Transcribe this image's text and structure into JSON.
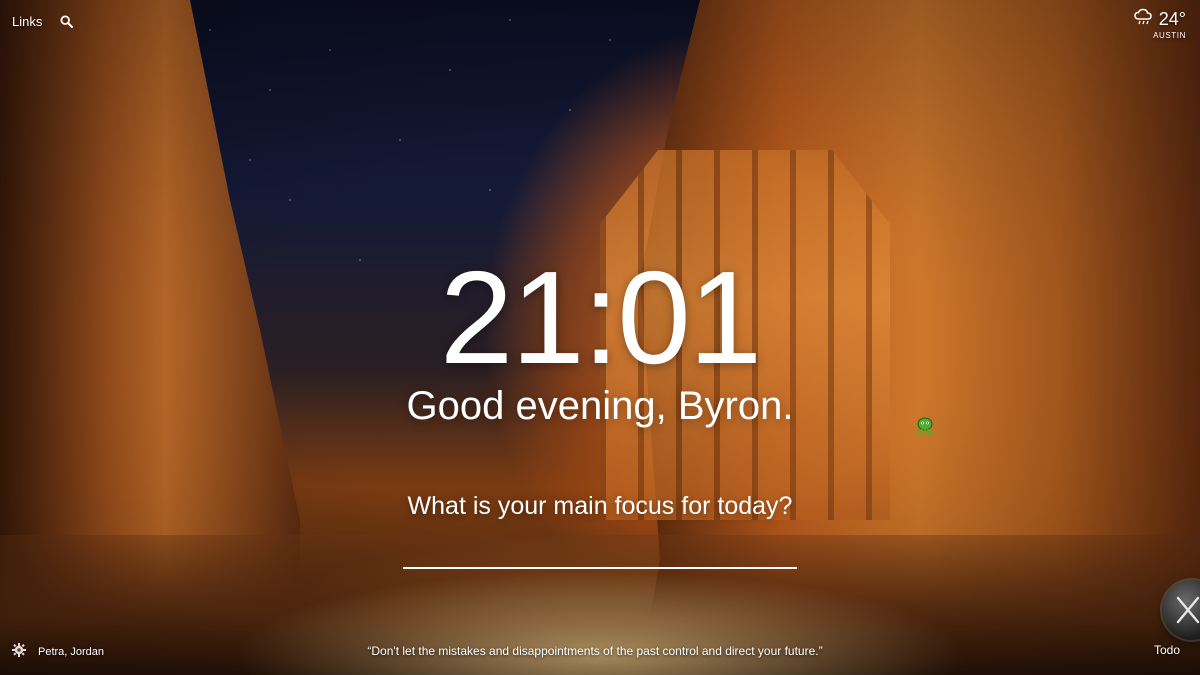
{
  "topbar": {
    "links_label": "Links",
    "search_icon": "search-icon"
  },
  "weather": {
    "icon": "cloud-rain-icon",
    "temperature": "24°",
    "location": "AUSTIN"
  },
  "dashboard": {
    "time": "21:01",
    "greeting": "Good evening, Byron.",
    "focus_question": "What is your main focus for today?",
    "focus_value": "",
    "mascot_icon": "octopus-icon"
  },
  "footer": {
    "settings_icon": "gear-icon",
    "photo_location": "Petra, Jordan",
    "quote": "“Don't let the mistakes and disappointments of the past control and direct your future.”",
    "todo_label": "Todo",
    "widget_icon": "x-dial-icon"
  },
  "colors": {
    "text": "#ffffff",
    "glow": "#ffd48a",
    "rock": "#c8702a",
    "sky": "#0c0f24"
  }
}
